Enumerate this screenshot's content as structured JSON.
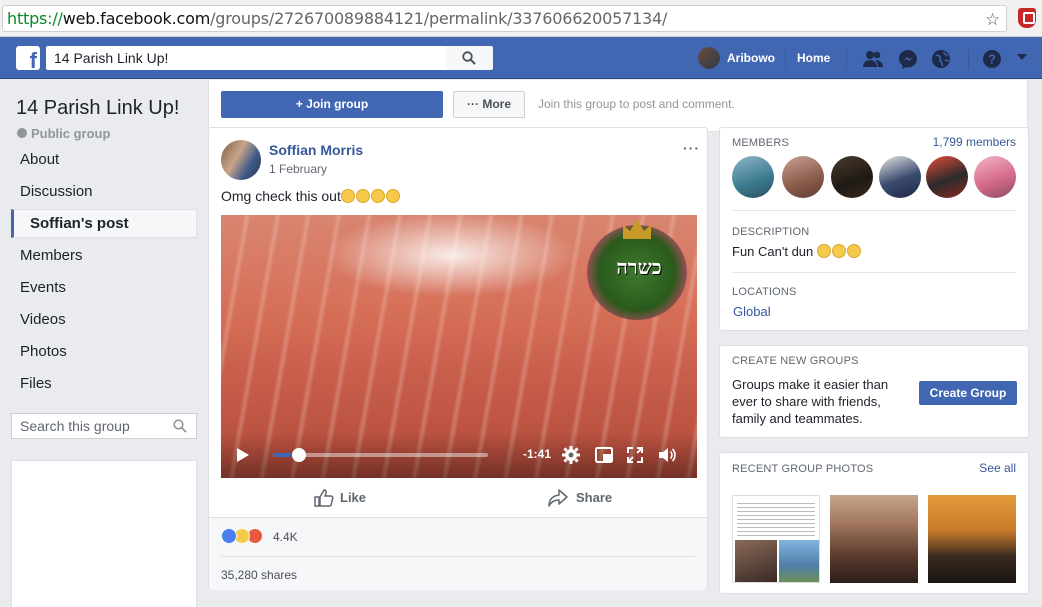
{
  "browser": {
    "url_scheme": "https://",
    "url_host": "web.facebook.com",
    "url_path": "/groups/272670089884121/permalink/337606620057134/"
  },
  "topbar": {
    "search_value": "14 Parish Link Up!",
    "user_name": "Aribowo",
    "home_label": "Home"
  },
  "sidebar": {
    "group_title": "14 Parish Link Up!",
    "privacy": "Public group",
    "items": [
      {
        "label": "About"
      },
      {
        "label": "Discussion"
      },
      {
        "label": "Soffian's post"
      },
      {
        "label": "Members"
      },
      {
        "label": "Events"
      },
      {
        "label": "Videos"
      },
      {
        "label": "Photos"
      },
      {
        "label": "Files"
      }
    ],
    "search_placeholder": "Search this group"
  },
  "joinbar": {
    "join_label": "+ Join group",
    "more_label": "··· More",
    "hint": "Join this group to post and comment."
  },
  "post": {
    "author": "Soffian Morris",
    "date": "1 February",
    "text": "Omg check this out",
    "video": {
      "time_remaining": "-1:41",
      "progress": 0.12,
      "watermark_text": "כשרה"
    },
    "like_label": "Like",
    "share_label": "Share",
    "reaction_count": "4.4K",
    "shares_text": "35,280 shares"
  },
  "members_card": {
    "label": "MEMBERS",
    "count_link": "1,799 members",
    "description_label": "DESCRIPTION",
    "description": "Fun Can't dun",
    "locations_label": "LOCATIONS",
    "location": "Global"
  },
  "create_card": {
    "label": "CREATE NEW GROUPS",
    "text_line1": "Groups make it easier than",
    "text_line2": "ever to share with friends,",
    "text_line3": "family and teammates.",
    "button_label": "Create Group"
  },
  "photos_card": {
    "label": "RECENT GROUP PHOTOS",
    "see_all": "See all"
  },
  "colors": {
    "fb_blue": "#4267b2",
    "link_blue": "#365899",
    "page_bg": "#e9ebee"
  }
}
